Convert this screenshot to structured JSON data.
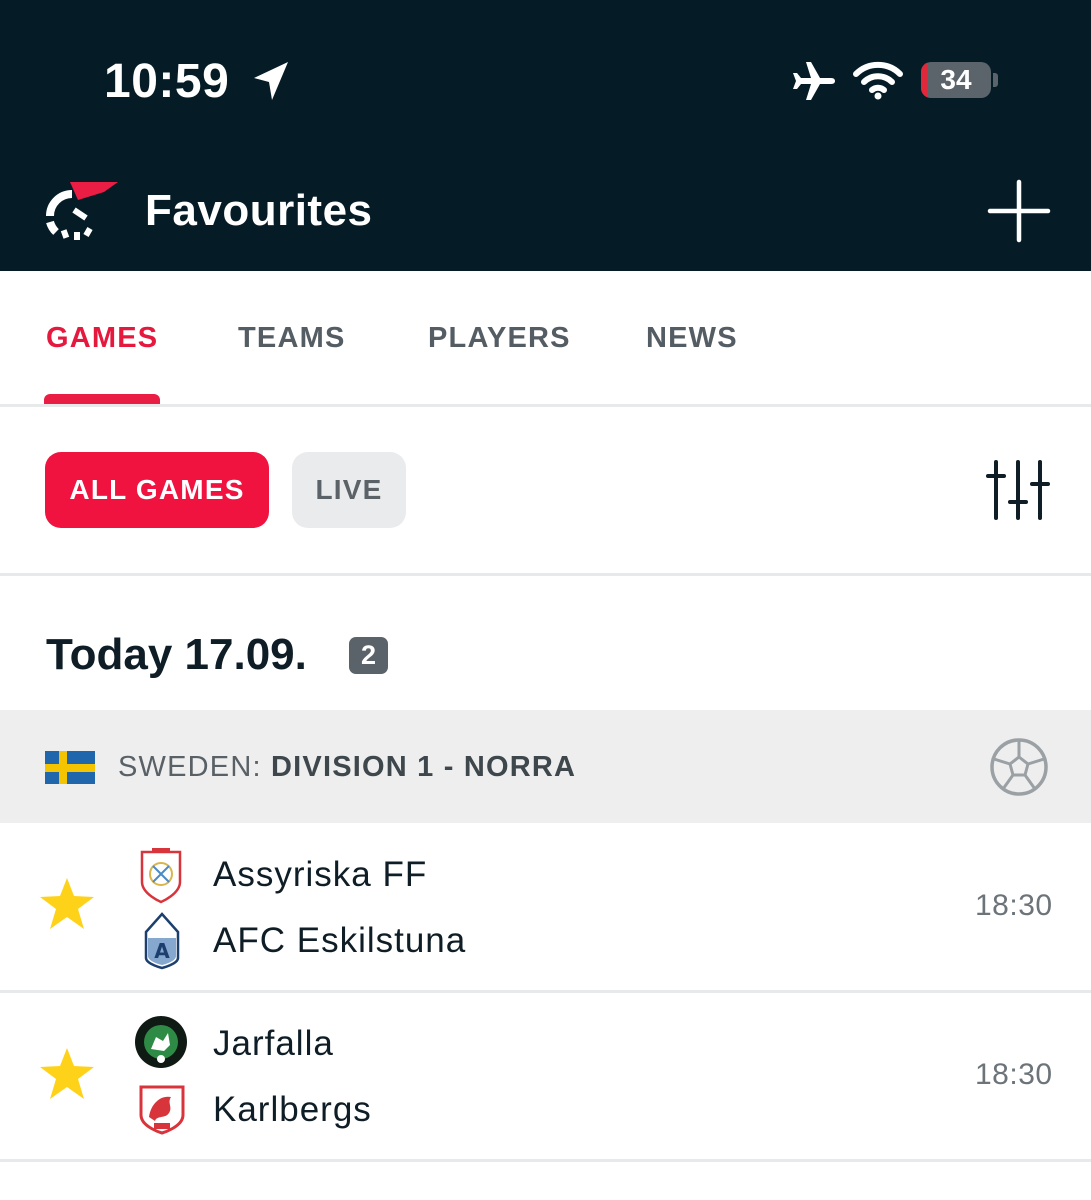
{
  "status_bar": {
    "time": "10:59",
    "battery": "34"
  },
  "header": {
    "title": "Favourites",
    "add_icon": "plus-icon",
    "logo_icon": "app-logo"
  },
  "tabs": [
    {
      "label": "GAMES",
      "active": true
    },
    {
      "label": "TEAMS",
      "active": false
    },
    {
      "label": "PLAYERS",
      "active": false
    },
    {
      "label": "NEWS",
      "active": false
    }
  ],
  "filters": {
    "all_games": "ALL GAMES",
    "live": "LIVE",
    "settings_icon": "sliders-icon"
  },
  "date_section": {
    "heading": "Today 17.09.",
    "count": "2"
  },
  "league": {
    "country": "SWEDEN: ",
    "name": "DIVISION 1 - NORRA",
    "sport_icon": "soccer-ball-icon"
  },
  "matches": [
    {
      "home": "Assyriska FF",
      "away": "AFC Eskilstuna",
      "time": "18:30",
      "favourite": true
    },
    {
      "home": "Jarfalla",
      "away": "Karlbergs",
      "time": "18:30",
      "favourite": true
    }
  ],
  "colors": {
    "header_bg": "#051c27",
    "accent": "#f0133f",
    "star": "#ffd21a"
  }
}
